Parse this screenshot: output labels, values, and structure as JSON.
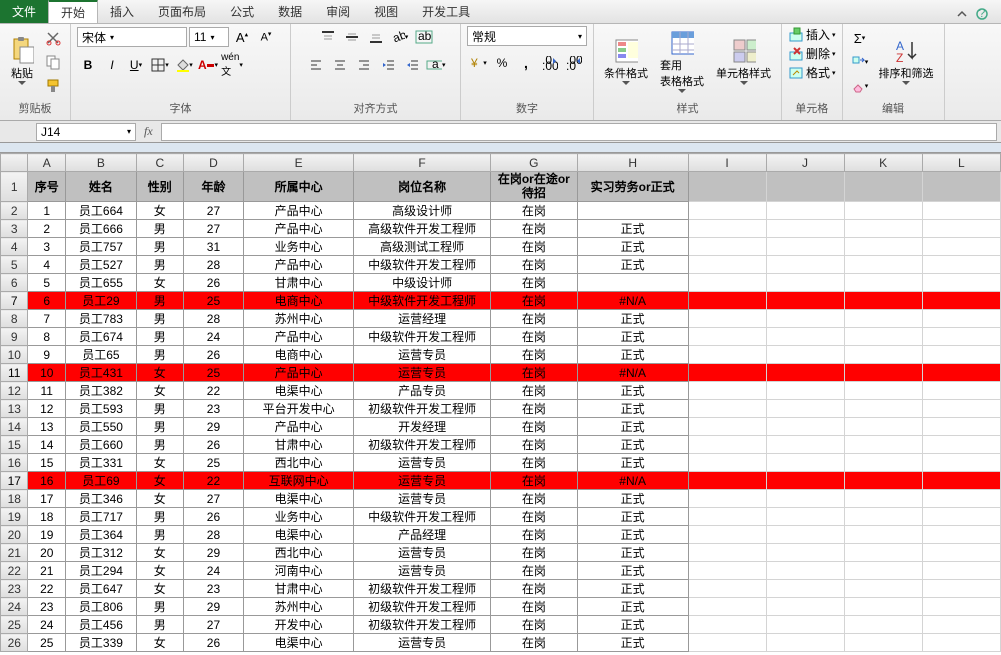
{
  "tabs": {
    "file": "文件",
    "items": [
      "开始",
      "插入",
      "页面布局",
      "公式",
      "数据",
      "审阅",
      "视图",
      "开发工具"
    ],
    "active": 0
  },
  "ribbon": {
    "clipboard": {
      "label": "剪贴板",
      "paste": "粘贴"
    },
    "font": {
      "label": "字体",
      "name": "宋体",
      "size": "11",
      "bold": "B",
      "italic": "I",
      "underline": "U"
    },
    "align": {
      "label": "对齐方式"
    },
    "number": {
      "label": "数字",
      "format": "常规"
    },
    "styles": {
      "label": "样式",
      "cond": "条件格式",
      "table": "套用\n表格格式",
      "cell": "单元格样式"
    },
    "cells": {
      "label": "单元格",
      "insert": "插入",
      "delete": "删除",
      "format": "格式"
    },
    "editing": {
      "label": "编辑",
      "sortfilter": "排序和筛选"
    }
  },
  "formula_bar": {
    "name_box": "J14",
    "fx": "fx"
  },
  "grid": {
    "columns": [
      "A",
      "B",
      "C",
      "D",
      "E",
      "F",
      "G",
      "H",
      "I",
      "J",
      "K",
      "L"
    ],
    "header": [
      "序号",
      "姓名",
      "性别",
      "年龄",
      "所属中心",
      "岗位名称",
      "在岗or在途or待招",
      "实习劳务or正式"
    ],
    "rows": [
      {
        "n": 1,
        "d": [
          "1",
          "员工664",
          "女",
          "27",
          "产品中心",
          "高级设计师",
          "在岗",
          ""
        ]
      },
      {
        "n": 2,
        "d": [
          "2",
          "员工666",
          "男",
          "27",
          "产品中心",
          "高级软件开发工程师",
          "在岗",
          "正式"
        ]
      },
      {
        "n": 3,
        "d": [
          "3",
          "员工757",
          "男",
          "31",
          "业务中心",
          "高级测试工程师",
          "在岗",
          "正式"
        ]
      },
      {
        "n": 4,
        "d": [
          "4",
          "员工527",
          "男",
          "28",
          "产品中心",
          "中级软件开发工程师",
          "在岗",
          "正式"
        ]
      },
      {
        "n": 5,
        "d": [
          "5",
          "员工655",
          "女",
          "26",
          "甘肃中心",
          "中级设计师",
          "在岗",
          ""
        ]
      },
      {
        "n": 6,
        "d": [
          "6",
          "员工29",
          "男",
          "25",
          "电商中心",
          "中级软件开发工程师",
          "在岗",
          "#N/A"
        ],
        "red": true
      },
      {
        "n": 7,
        "d": [
          "7",
          "员工783",
          "男",
          "28",
          "苏州中心",
          "运营经理",
          "在岗",
          "正式"
        ]
      },
      {
        "n": 8,
        "d": [
          "8",
          "员工674",
          "男",
          "24",
          "产品中心",
          "中级软件开发工程师",
          "在岗",
          "正式"
        ]
      },
      {
        "n": 9,
        "d": [
          "9",
          "员工65",
          "男",
          "26",
          "电商中心",
          "运营专员",
          "在岗",
          "正式"
        ]
      },
      {
        "n": 10,
        "d": [
          "10",
          "员工431",
          "女",
          "25",
          "产品中心",
          "运营专员",
          "在岗",
          "#N/A"
        ],
        "red": true
      },
      {
        "n": 11,
        "d": [
          "11",
          "员工382",
          "女",
          "22",
          "电渠中心",
          "产品专员",
          "在岗",
          "正式"
        ]
      },
      {
        "n": 12,
        "d": [
          "12",
          "员工593",
          "男",
          "23",
          "平台开发中心",
          "初级软件开发工程师",
          "在岗",
          "正式"
        ]
      },
      {
        "n": 13,
        "d": [
          "13",
          "员工550",
          "男",
          "29",
          "产品中心",
          "开发经理",
          "在岗",
          "正式"
        ]
      },
      {
        "n": 14,
        "d": [
          "14",
          "员工660",
          "男",
          "26",
          "甘肃中心",
          "初级软件开发工程师",
          "在岗",
          "正式"
        ]
      },
      {
        "n": 15,
        "d": [
          "15",
          "员工331",
          "女",
          "25",
          "西北中心",
          "运营专员",
          "在岗",
          "正式"
        ]
      },
      {
        "n": 16,
        "d": [
          "16",
          "员工69",
          "女",
          "22",
          "互联网中心",
          "运营专员",
          "在岗",
          "#N/A"
        ],
        "red": true
      },
      {
        "n": 17,
        "d": [
          "17",
          "员工346",
          "女",
          "27",
          "电渠中心",
          "运营专员",
          "在岗",
          "正式"
        ]
      },
      {
        "n": 18,
        "d": [
          "18",
          "员工717",
          "男",
          "26",
          "业务中心",
          "中级软件开发工程师",
          "在岗",
          "正式"
        ]
      },
      {
        "n": 19,
        "d": [
          "19",
          "员工364",
          "男",
          "28",
          "电渠中心",
          "产品经理",
          "在岗",
          "正式"
        ]
      },
      {
        "n": 20,
        "d": [
          "20",
          "员工312",
          "女",
          "29",
          "西北中心",
          "运营专员",
          "在岗",
          "正式"
        ]
      },
      {
        "n": 21,
        "d": [
          "21",
          "员工294",
          "女",
          "24",
          "河南中心",
          "运营专员",
          "在岗",
          "正式"
        ]
      },
      {
        "n": 22,
        "d": [
          "22",
          "员工647",
          "女",
          "23",
          "甘肃中心",
          "初级软件开发工程师",
          "在岗",
          "正式"
        ]
      },
      {
        "n": 23,
        "d": [
          "23",
          "员工806",
          "男",
          "29",
          "苏州中心",
          "初级软件开发工程师",
          "在岗",
          "正式"
        ]
      },
      {
        "n": 24,
        "d": [
          "24",
          "员工456",
          "男",
          "27",
          "开发中心",
          "初级软件开发工程师",
          "在岗",
          "正式"
        ]
      },
      {
        "n": 25,
        "d": [
          "25",
          "员工339",
          "女",
          "26",
          "电渠中心",
          "运营专员",
          "在岗",
          "正式"
        ]
      }
    ]
  }
}
